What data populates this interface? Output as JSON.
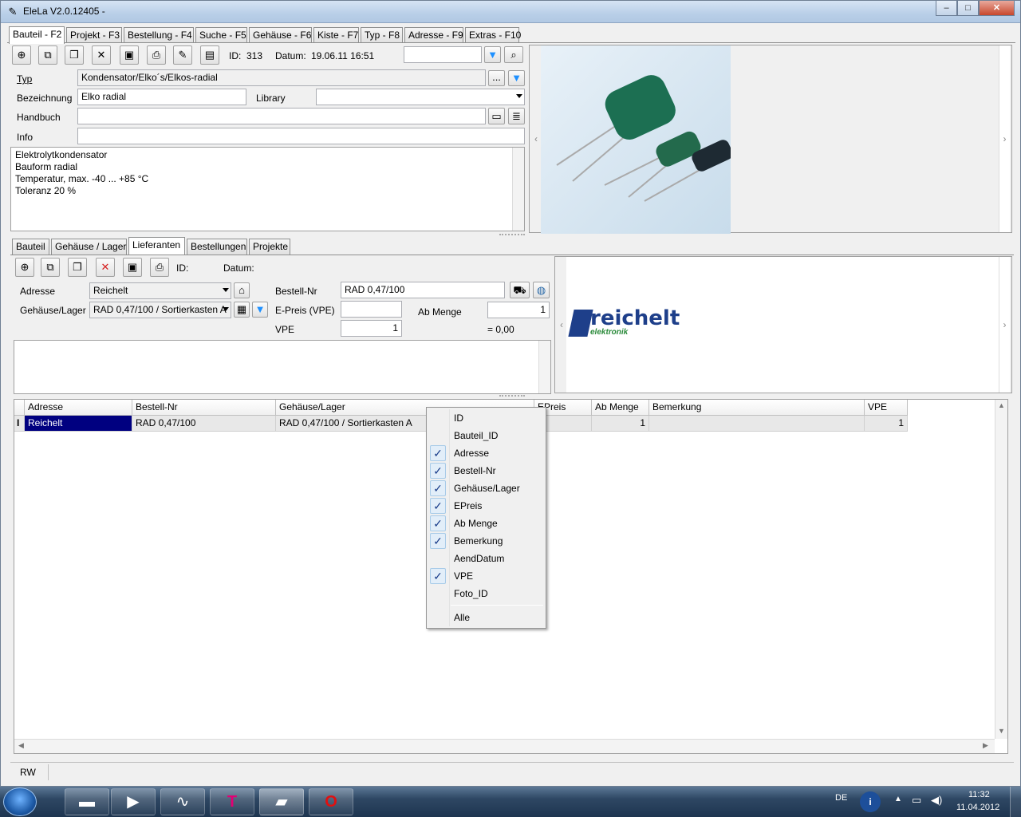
{
  "window": {
    "title": "EleLa V2.0.12405  -",
    "min": "–",
    "max": "□",
    "close": "✕"
  },
  "main_tabs": [
    "Bauteil - F2",
    "Projekt - F3",
    "Bestellung - F4",
    "Suche - F5",
    "Gehäuse - F6",
    "Kiste - F7",
    "Typ - F8",
    "Adresse - F9",
    "Extras - F10"
  ],
  "top_toolbar": {
    "id_label": "ID:",
    "id_value": "313",
    "datum_label": "Datum:",
    "datum_value": "19.06.11 16:51",
    "search_value": ""
  },
  "part": {
    "typ_label": "Typ",
    "typ_value": "Kondensator/Elko´s/Elkos-radial",
    "typ_btn": "...",
    "bezeichnung_label": "Bezeichnung",
    "bezeichnung_value": "Elko radial",
    "library_label": "Library",
    "library_value": "",
    "handbuch_label": "Handbuch",
    "handbuch_value": "",
    "info_label": "Info",
    "info_value": "",
    "description": [
      "Elektrolytkondensator",
      "Bauform radial",
      "Temperatur, max. -40 ... +85 °C",
      "Toleranz 20 %"
    ]
  },
  "sub_tabs": [
    "Bauteil",
    "Gehäuse / Lager",
    "Lieferanten",
    "Bestellungen",
    "Projekte"
  ],
  "supplier": {
    "id_label": "ID:",
    "datum_label": "Datum:",
    "adresse_label": "Adresse",
    "adresse_value": "Reichelt",
    "gehaeuse_label": "Gehäuse/Lager",
    "gehaeuse_value": "RAD 0,47/100 / Sortierkasten A",
    "bestellnr_label": "Bestell-Nr",
    "bestellnr_value": "RAD 0,47/100",
    "epreis_label": "E-Preis (VPE)",
    "epreis_value": "",
    "abmenge_label": "Ab Menge",
    "abmenge_value": "1",
    "vpe_label": "VPE",
    "vpe_value": "1",
    "sum_value": "= 0,00",
    "logo_main": "reichelt",
    "logo_sub": "elektronik"
  },
  "grid": {
    "headers": [
      "Adresse",
      "Bestell-Nr",
      "Gehäuse/Lager",
      "EPreis",
      "Ab Menge",
      "Bemerkung",
      "VPE"
    ],
    "rows": [
      [
        "Reichelt",
        "RAD 0,47/100",
        "RAD 0,47/100 / Sortierkasten A",
        "",
        "1",
        "",
        "1"
      ]
    ],
    "row_indicator": "I"
  },
  "context_menu": [
    {
      "label": "ID",
      "checked": false
    },
    {
      "label": "Bauteil_ID",
      "checked": false
    },
    {
      "label": "Adresse",
      "checked": true
    },
    {
      "label": "Bestell-Nr",
      "checked": true
    },
    {
      "label": "Gehäuse/Lager",
      "checked": true
    },
    {
      "label": "EPreis",
      "checked": true
    },
    {
      "label": "Ab Menge",
      "checked": true
    },
    {
      "label": "Bemerkung",
      "checked": true
    },
    {
      "label": "AendDatum",
      "checked": false
    },
    {
      "label": "VPE",
      "checked": true
    },
    {
      "label": "Foto_ID",
      "checked": false
    },
    {
      "label": "Alle",
      "checked": false
    }
  ],
  "status": {
    "mode": "RW"
  },
  "taskbar": {
    "lang": "DE",
    "time": "11:32",
    "date": "11.04.2012"
  },
  "colors": {
    "selection": "#000080",
    "taskbar": "#2e4763",
    "accent": "#1e90ff"
  }
}
